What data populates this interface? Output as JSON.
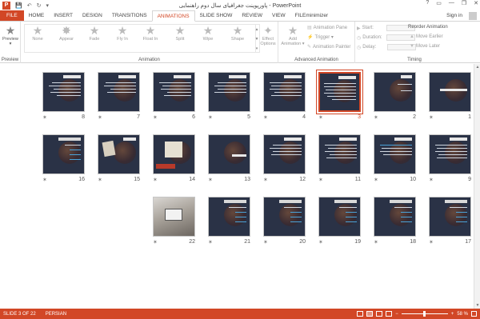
{
  "window": {
    "title": "پاورپوینت جغرافیای سال دوم راهنمایی - PowerPoint",
    "app_icon": "P",
    "controls": [
      "?",
      "▭",
      "—",
      "❐",
      "✕"
    ]
  },
  "quick_access": [
    "💾",
    "↶",
    "↻",
    "▾"
  ],
  "tabs": [
    {
      "label": "FILE"
    },
    {
      "label": "HOME"
    },
    {
      "label": "INSERT"
    },
    {
      "label": "DESIGN"
    },
    {
      "label": "TRANSITIONS"
    },
    {
      "label": "ANIMATIONS"
    },
    {
      "label": "SLIDE SHOW"
    },
    {
      "label": "REVIEW"
    },
    {
      "label": "VIEW"
    },
    {
      "label": "FILEminimizer"
    }
  ],
  "active_tab": "ANIMATIONS",
  "sign_in": "Sign in",
  "ribbon": {
    "preview": {
      "label": "Preview",
      "group": "Preview"
    },
    "animations": {
      "group": "Animation",
      "items": [
        "None",
        "Appear",
        "Fade",
        "Fly In",
        "Float In",
        "Split",
        "Wipe",
        "Shape"
      ],
      "effect_options": "Effect Options",
      "effect_options_2": "Options ▾"
    },
    "advanced": {
      "group": "Advanced Animation",
      "add_animation": "Add",
      "add_animation_2": "Animation ▾",
      "pane": "Animation Pane",
      "trigger": "Trigger ▾",
      "painter": "Animation Painter"
    },
    "timing": {
      "group": "Timing",
      "start": "Start:",
      "duration": "Duration:",
      "delay": "Delay:",
      "reorder": "Reorder Animation",
      "earlier": "Move Earlier",
      "later": "Move Later"
    }
  },
  "slides": [
    {
      "n": "1"
    },
    {
      "n": "2"
    },
    {
      "n": "3"
    },
    {
      "n": "4"
    },
    {
      "n": "5"
    },
    {
      "n": "6"
    },
    {
      "n": "7"
    },
    {
      "n": "8"
    },
    {
      "n": "9"
    },
    {
      "n": "10"
    },
    {
      "n": "11"
    },
    {
      "n": "12"
    },
    {
      "n": "13"
    },
    {
      "n": "14"
    },
    {
      "n": "15"
    },
    {
      "n": "16"
    },
    {
      "n": "17"
    },
    {
      "n": "18"
    },
    {
      "n": "19"
    },
    {
      "n": "20"
    },
    {
      "n": "21"
    },
    {
      "n": "22"
    }
  ],
  "selected_slide": "3",
  "status": {
    "slide": "SLIDE 3 OF 22",
    "language": "PERSIAN",
    "zoom": "58 %"
  }
}
